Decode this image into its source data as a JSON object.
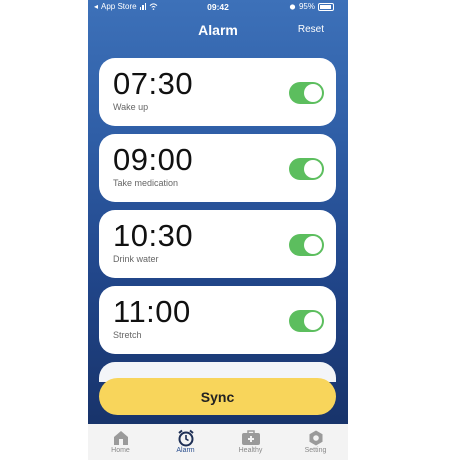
{
  "status_bar": {
    "carrier": "App Store",
    "time": "09:42",
    "battery": "95%"
  },
  "header": {
    "title": "Alarm",
    "reset": "Reset"
  },
  "alarms": [
    {
      "time": "07:30",
      "label": "Wake up",
      "enabled": true
    },
    {
      "time": "09:00",
      "label": "Take medication",
      "enabled": true
    },
    {
      "time": "10:30",
      "label": "Drink water",
      "enabled": true
    },
    {
      "time": "11:00",
      "label": "Stretch",
      "enabled": true
    }
  ],
  "sync_label": "Sync",
  "tabs": [
    {
      "label": "Home",
      "icon": "home-icon"
    },
    {
      "label": "Alarm",
      "icon": "alarm-clock-icon",
      "active": true
    },
    {
      "label": "Healthy",
      "icon": "medical-kit-icon"
    },
    {
      "label": "Setting",
      "icon": "gear-icon"
    }
  ],
  "colors": {
    "accent": "#f8d55b",
    "toggle_on": "#5cbe5e",
    "active_tab": "#2a4e8e"
  }
}
